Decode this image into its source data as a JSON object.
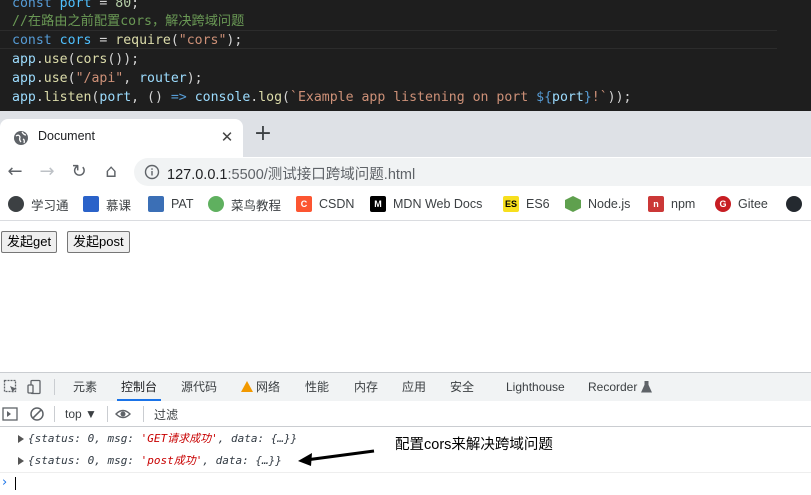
{
  "editor": {
    "line1": {
      "kw": "const",
      "name": "port",
      "op": " = ",
      "num": "80",
      "end": ";"
    },
    "line2": {
      "comment": "//在路由之前配置cors，解决跨域问题"
    },
    "line3": {
      "kw": "const",
      "name": "cors",
      "op": " = ",
      "fn": "require",
      "open": "(",
      "str": "\"cors\"",
      "close": ");"
    },
    "line4": {
      "obj": "app",
      "dot": ".",
      "fn": "use",
      "open": "(",
      "fn2": "cors",
      "close": "());"
    },
    "line5": {
      "obj": "app",
      "dot": ".",
      "fn": "use",
      "open": "(",
      "str": "\"/api\"",
      "comma": ", ",
      "arg": "router",
      "close": ");"
    },
    "line6": {
      "obj": "app",
      "dot": ".",
      "fn": "listen",
      "open": "(",
      "arg": "port",
      "mid": ", () ",
      "arrow": "=>",
      "sp": " ",
      "obj2": "console",
      "dot2": ".",
      "fn2": "log",
      "open2": "(",
      "tpl1": "`Example app listening on port ",
      "tplopen": "${",
      "tplvar": "port",
      "tplclose": "}",
      "tpl2": "!`",
      "close": "));"
    }
  },
  "browser": {
    "tab_title": "Document",
    "tab_close": "✕",
    "new_tab": "+",
    "url_host": "127.0.0.1",
    "url_rest": ":5500/测试接口跨域问题.html",
    "nav": {
      "back": "←",
      "forward": "→",
      "reload": "↻",
      "home": "⌂"
    },
    "bookmarks": [
      {
        "label": "学习通",
        "icon": "xuexitong-icon",
        "color": "#3c4043"
      },
      {
        "label": "慕课",
        "icon": "mooc-icon",
        "color": "#2a62c9"
      },
      {
        "label": "PAT",
        "icon": "pat-icon",
        "color": "#3b6fb6"
      },
      {
        "label": "菜鸟教程",
        "icon": "runoob-icon",
        "color": "#5fb05f"
      },
      {
        "label": "CSDN",
        "icon": "csdn-icon",
        "color": "#fc5531"
      },
      {
        "label": "MDN Web Docs",
        "icon": "mdn-icon",
        "color": "#000000"
      },
      {
        "label": "ES6",
        "icon": "es6-icon",
        "color": "#f7df1e"
      },
      {
        "label": "Node.js",
        "icon": "nodejs-icon",
        "color": "#5fa04e"
      },
      {
        "label": "npm",
        "icon": "npm-icon",
        "color": "#cb3837"
      },
      {
        "label": "Gitee",
        "icon": "gitee-icon",
        "color": "#c71d23"
      },
      {
        "label": "",
        "icon": "github-icon",
        "color": "#24292f"
      }
    ]
  },
  "page": {
    "btn_get": "发起get",
    "btn_post": "发起post"
  },
  "devtools": {
    "tabs": [
      "元素",
      "控制台",
      "源代码",
      "网络",
      "性能",
      "内存",
      "应用",
      "安全",
      "Lighthouse",
      "Recorder"
    ],
    "active_tab": "控制台",
    "context": "top ▼",
    "filter_placeholder": "过滤",
    "logs": [
      {
        "pre": "{status: ",
        "status": "0",
        "mid": ", msg: ",
        "msg": "'GET请求成功'",
        "post": ", data: {…}}"
      },
      {
        "pre": "{status: ",
        "status": "0",
        "mid": ", msg: ",
        "msg": "'post成功'",
        "post": ", data: {…}}"
      }
    ],
    "prompt": "›"
  },
  "annotation": {
    "text": "配置cors来解决跨域问题"
  },
  "colors": {
    "accent": "#1a73e8",
    "warning": "#f29900",
    "editor_bg": "#1e1e1e"
  }
}
